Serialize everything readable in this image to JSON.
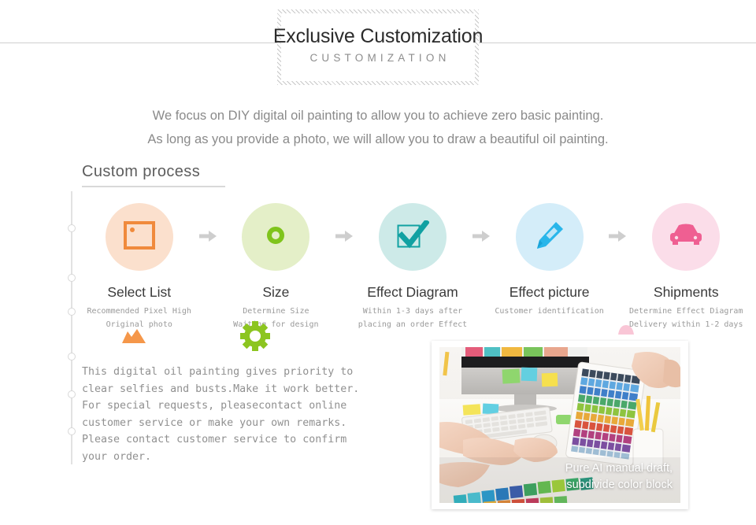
{
  "banner": {
    "title": "Exclusive Customization",
    "subtitle": "CUSTOMIZATION"
  },
  "intro": {
    "line1": "We focus on DIY digital oil painting to allow you to achieve zero basic painting.",
    "line2": "As long as you provide a photo, we will allow you to draw a beautiful oil painting."
  },
  "section": {
    "title": "Custom process"
  },
  "steps": [
    {
      "icon": "picture-icon",
      "title": "Select List",
      "caption_line1": "Recommended Pixel High",
      "caption_line2": "Original photo",
      "circle_color": "#fbe0cd",
      "icon_color": "#f08a3c"
    },
    {
      "icon": "ring-icon",
      "title": "Size",
      "caption_line1": "Determine Size",
      "caption_line2": "Waiting for design",
      "circle_color": "#e4efc8",
      "icon_color": "#7fc41c"
    },
    {
      "icon": "checkbox-icon",
      "title": "Effect Diagram",
      "caption_line1": "Within 1-3 days after",
      "caption_line2": "placing an order Effect",
      "circle_color": "#cdeae8",
      "icon_color": "#11a1a2"
    },
    {
      "icon": "pencil-icon",
      "title": "Effect picture",
      "caption_line1": "Customer identification",
      "caption_line2": "",
      "circle_color": "#d4edf9",
      "icon_color": "#29b6ea"
    },
    {
      "icon": "car-icon",
      "title": "Shipments",
      "caption_line1": "Determine Effect Diagram",
      "caption_line2": "Delivery within 1-2 days",
      "circle_color": "#fbdde9",
      "icon_color": "#ef5f92"
    }
  ],
  "arrow_icon": "arrow-right-icon",
  "decorations": {
    "mountain_color": "#f5974a",
    "gear_color": "#8cc520",
    "pink_color": "#f9c6d6"
  },
  "body": {
    "line1": "This digital oil painting gives priority to",
    "line2": "clear selfies and busts.Make it work better.",
    "line3": "For special requests, pleasecontact online",
    "line4": "customer service or make your own remarks.",
    "line5": "Please contact customer service to confirm",
    "line6": "your order."
  },
  "photo": {
    "caption_line1": "Pure AI manual draft,",
    "caption_line2": "subdivide color block",
    "alt": "hands typing on keyboard with tablet showing color palette"
  }
}
